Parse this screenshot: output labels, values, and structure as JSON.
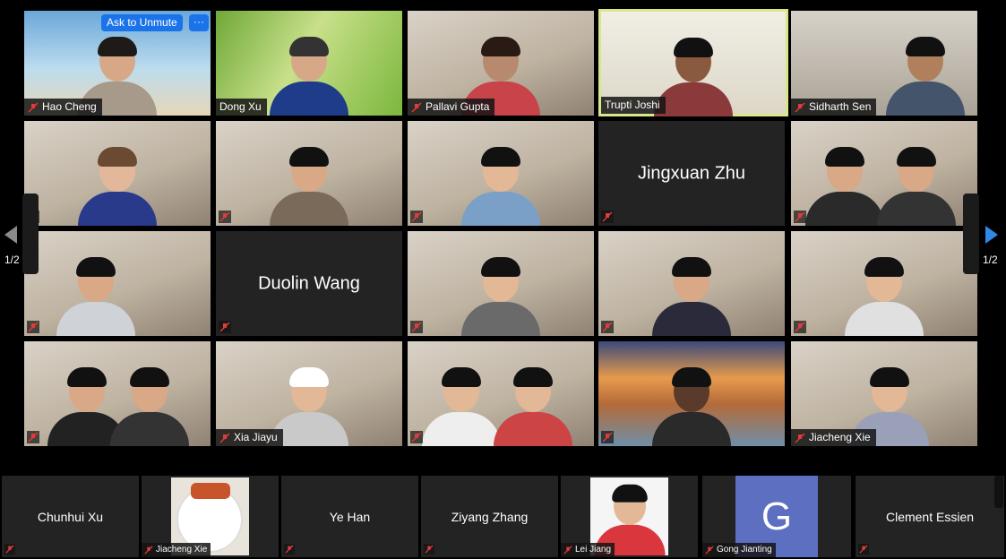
{
  "controls": {
    "ask_to_unmute": "Ask to Unmute",
    "more": "···",
    "page_left": "1/2",
    "page_right": "1/2"
  },
  "participants": [
    {
      "name": "Hao Cheng"
    },
    {
      "name": "Dong Xu"
    },
    {
      "name": "Pallavi Gupta"
    },
    {
      "name": "Trupti Joshi"
    },
    {
      "name": "Sidharth Sen"
    },
    {
      "name": ""
    },
    {
      "name": ""
    },
    {
      "name": ""
    },
    {
      "name": "Jingxuan Zhu"
    },
    {
      "name": ""
    },
    {
      "name": ""
    },
    {
      "name": "Duolin Wang"
    },
    {
      "name": ""
    },
    {
      "name": ""
    },
    {
      "name": ""
    },
    {
      "name": ""
    },
    {
      "name": "Xia Jiayu"
    },
    {
      "name": ""
    },
    {
      "name": ""
    },
    {
      "name": "Jiacheng Xie"
    }
  ],
  "strip": [
    {
      "name": "Chunhui Xu"
    },
    {
      "name": "Jiacheng Xie"
    },
    {
      "name": "Ye Han"
    },
    {
      "name": "Ziyang Zhang"
    },
    {
      "name": "Lei Jiang"
    },
    {
      "name": "Gong Jianting",
      "avatar": "G"
    },
    {
      "name": "Clement Essien"
    }
  ],
  "colors": {
    "accent": "#1a73e8",
    "active_speaker": "#d9e68a",
    "mute": "#e03a3a",
    "nav_arrow_right": "#2e8ae6"
  }
}
